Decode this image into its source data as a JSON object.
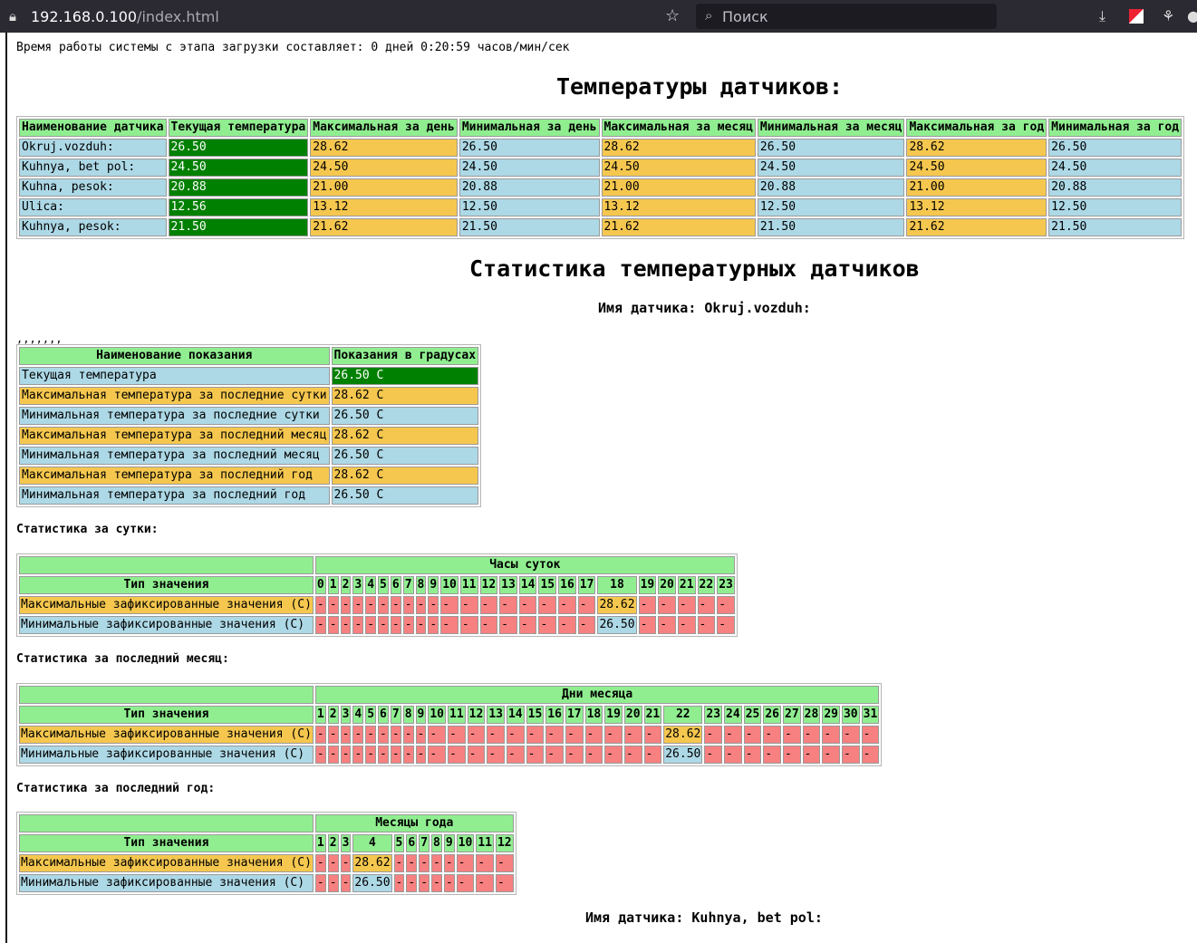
{
  "browser": {
    "url_host": "192.168.0.100",
    "url_path": "/index.html",
    "search_placeholder": "Поиск"
  },
  "uptime": "Время работы системы с этапа загрузки составляет: 0 дней 0:20:59 часов/мин/сек",
  "sensors_title": "Температуры датчиков:",
  "sensors_table": {
    "headers": [
      "Наименование датчика",
      "Текущая температура",
      "Максимальная за день",
      "Минимальная за день",
      "Максимальная за месяц",
      "Минимальная за месяц",
      "Максимальная за год",
      "Минимальная за год"
    ],
    "rows": [
      [
        "Okruj.vozduh:",
        "26.50",
        "28.62",
        "26.50",
        "28.62",
        "26.50",
        "28.62",
        "26.50"
      ],
      [
        "Kuhnya, bet pol:",
        "24.50",
        "24.50",
        "24.50",
        "24.50",
        "24.50",
        "24.50",
        "24.50"
      ],
      [
        "Kuhna, pesok:",
        "20.88",
        "21.00",
        "20.88",
        "21.00",
        "20.88",
        "21.00",
        "20.88"
      ],
      [
        "Ulica:",
        "12.56",
        "13.12",
        "12.50",
        "13.12",
        "12.50",
        "13.12",
        "12.50"
      ],
      [
        "Kuhnya, pesok:",
        "21.50",
        "21.62",
        "21.50",
        "21.62",
        "21.50",
        "21.62",
        "21.50"
      ]
    ]
  },
  "stats_title": "Статистика температурных датчиков",
  "sensor1_name": "Имя датчика: Okruj.vozduh:",
  "commas": ",,,,,,,",
  "readings": {
    "headers": [
      "Наименование показания",
      "Показания в градусах"
    ],
    "rows": [
      [
        "Текущая температура",
        "26.50 C"
      ],
      [
        "Максимальная температура за последние сутки",
        "28.62 C"
      ],
      [
        "Минимальная температура за последние сутки",
        "26.50 C"
      ],
      [
        "Максимальная температура за последний месяц",
        "28.62 C"
      ],
      [
        "Минимальная температура за последний месяц",
        "26.50 C"
      ],
      [
        "Максимальная температура за последний год",
        "28.62 C"
      ],
      [
        "Минимальная температура за последний год",
        "26.50 C"
      ]
    ]
  },
  "row_labels": {
    "type": "Тип значения",
    "max": "Максимальные зафиксированные значения (С)",
    "min": "Минимальные зафиксированные значения (С)"
  },
  "day_stats": {
    "title": "Статистика за сутки:",
    "group_header": "Часы суток",
    "cols": [
      "0",
      "1",
      "2",
      "3",
      "4",
      "5",
      "6",
      "7",
      "8",
      "9",
      "10",
      "11",
      "12",
      "13",
      "14",
      "15",
      "16",
      "17",
      "18",
      "19",
      "20",
      "21",
      "22",
      "23"
    ],
    "max": [
      "-",
      "-",
      "-",
      "-",
      "-",
      "-",
      "-",
      "-",
      "-",
      "-",
      "-",
      "-",
      "-",
      "-",
      "-",
      "-",
      "-",
      "-",
      "28.62",
      "-",
      "-",
      "-",
      "-",
      "-"
    ],
    "min": [
      "-",
      "-",
      "-",
      "-",
      "-",
      "-",
      "-",
      "-",
      "-",
      "-",
      "-",
      "-",
      "-",
      "-",
      "-",
      "-",
      "-",
      "-",
      "26.50",
      "-",
      "-",
      "-",
      "-",
      "-"
    ]
  },
  "month_stats": {
    "title": "Статистика за последний месяц:",
    "group_header": "Дни месяца",
    "cols": [
      "1",
      "2",
      "3",
      "4",
      "5",
      "6",
      "7",
      "8",
      "9",
      "10",
      "11",
      "12",
      "13",
      "14",
      "15",
      "16",
      "17",
      "18",
      "19",
      "20",
      "21",
      "22",
      "23",
      "24",
      "25",
      "26",
      "27",
      "28",
      "29",
      "30",
      "31"
    ],
    "max": [
      "-",
      "-",
      "-",
      "-",
      "-",
      "-",
      "-",
      "-",
      "-",
      "-",
      "-",
      "-",
      "-",
      "-",
      "-",
      "-",
      "-",
      "-",
      "-",
      "-",
      "-",
      "28.62",
      "-",
      "-",
      "-",
      "-",
      "-",
      "-",
      "-",
      "-",
      "-"
    ],
    "min": [
      "-",
      "-",
      "-",
      "-",
      "-",
      "-",
      "-",
      "-",
      "-",
      "-",
      "-",
      "-",
      "-",
      "-",
      "-",
      "-",
      "-",
      "-",
      "-",
      "-",
      "-",
      "26.50",
      "-",
      "-",
      "-",
      "-",
      "-",
      "-",
      "-",
      "-",
      "-"
    ]
  },
  "year_stats": {
    "title": "Статистика за последний год:",
    "group_header": "Месяцы года",
    "cols": [
      "1",
      "2",
      "3",
      "4",
      "5",
      "6",
      "7",
      "8",
      "9",
      "10",
      "11",
      "12"
    ],
    "max": [
      "-",
      "-",
      "-",
      "28.62",
      "-",
      "-",
      "-",
      "-",
      "-",
      "-",
      "-",
      "-"
    ],
    "min": [
      "-",
      "-",
      "-",
      "26.50",
      "-",
      "-",
      "-",
      "-",
      "-",
      "-",
      "-",
      "-"
    ]
  },
  "sensor2_name": "Имя датчика: Kuhnya, bet pol:",
  "colors": {
    "header": "#90ee90",
    "cell": "#add8e6",
    "current": "#008000",
    "max": "#f5c74f",
    "empty": "#f78080"
  }
}
